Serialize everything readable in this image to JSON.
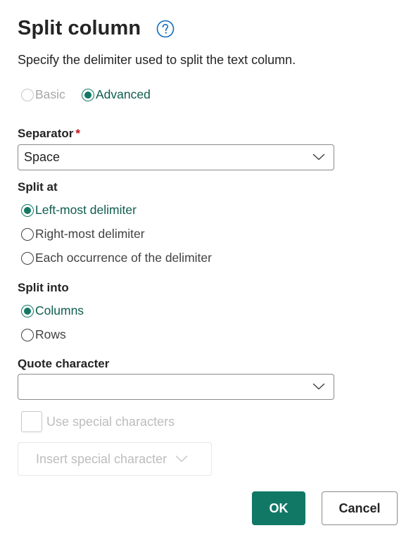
{
  "dialog": {
    "title": "Split column",
    "subtitle": "Specify the delimiter used to split the text column."
  },
  "mode": {
    "basic_label": "Basic",
    "advanced_label": "Advanced",
    "selected": "Advanced"
  },
  "separator": {
    "label": "Separator",
    "required_mark": "*",
    "value": "Space"
  },
  "split_at": {
    "label": "Split at",
    "options": [
      "Left-most delimiter",
      "Right-most delimiter",
      "Each occurrence of the delimiter"
    ],
    "selected": "Left-most delimiter"
  },
  "split_into": {
    "label": "Split into",
    "options": [
      "Columns",
      "Rows"
    ],
    "selected": "Columns"
  },
  "quote_character": {
    "label": "Quote character",
    "value": ""
  },
  "special": {
    "checkbox_label": "Use special characters",
    "insert_label": "Insert special character"
  },
  "buttons": {
    "ok": "OK",
    "cancel": "Cancel"
  },
  "colors": {
    "accent": "#117865",
    "help_icon": "#0f6cbd",
    "required": "#c50f1f"
  }
}
